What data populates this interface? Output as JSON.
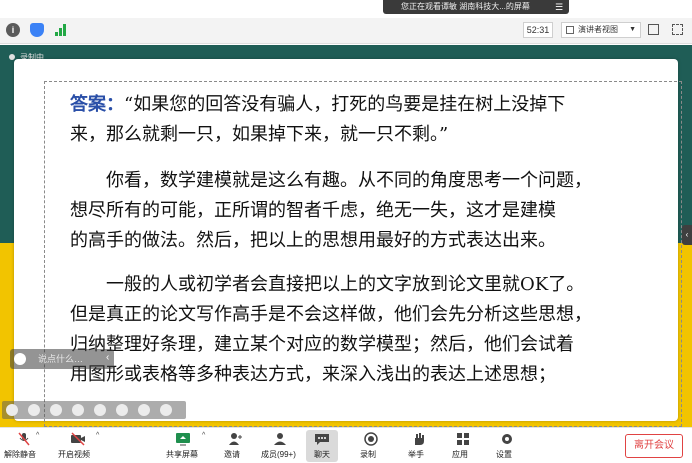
{
  "banner": {
    "sharing_text": "您正在观看谭敏 湖南科技大...的屏幕",
    "menu_icon": "menu-icon"
  },
  "toolbar": {
    "timer": "52:31",
    "view_mode": "演讲者视图"
  },
  "screen": {
    "recording_label": "录制中",
    "slide": {
      "answer_label": "答案：",
      "lines": [
        "“如果您的回答没有骗人，打死的鸟要是挂在树上没掉下",
        "来，那么就剩一只，如果掉下来，就一只不剩。”",
        "你看，数学建模就是这么有趣。从不同的角度思考一个问题，",
        "想尽所有的可能，正所谓的智者千虑，绝无一失，这才是建模",
        "的高手的做法。然后，把以上的思想用最好的方式表达出来。",
        "一般的人或初学者会直接把以上的文字放到论文里就OK了。",
        "但是真正的论文写作高手是不会这样做，他们会先分析这些思想，",
        "归纳整理好条理，建立某个对应的数学模型；然后，他们会试着",
        "用图形或表格等多种表达方式，来深入浅出的表达上述思想；"
      ]
    },
    "chat_hint": "说点什么…"
  },
  "bottom_bar": {
    "items": [
      {
        "label": "解除静音",
        "icon": "mic-muted-icon"
      },
      {
        "label": "开启视频",
        "icon": "video-off-icon"
      },
      {
        "label": "共享屏幕",
        "icon": "screen-share-icon"
      },
      {
        "label": "邀请",
        "icon": "invite-icon"
      },
      {
        "label": "成员(99+)",
        "icon": "members-icon"
      },
      {
        "label": "聊天",
        "icon": "chat-icon"
      },
      {
        "label": "录制",
        "icon": "record-icon"
      },
      {
        "label": "举手",
        "icon": "raise-hand-icon"
      },
      {
        "label": "应用",
        "icon": "apps-icon"
      },
      {
        "label": "设置",
        "icon": "settings-icon"
      }
    ],
    "leave_label": "离开会议"
  },
  "colors": {
    "teal": "#1f5d56",
    "yellow": "#f2c400",
    "answer_blue": "#2a4fa8",
    "leave_red": "#e04343"
  }
}
